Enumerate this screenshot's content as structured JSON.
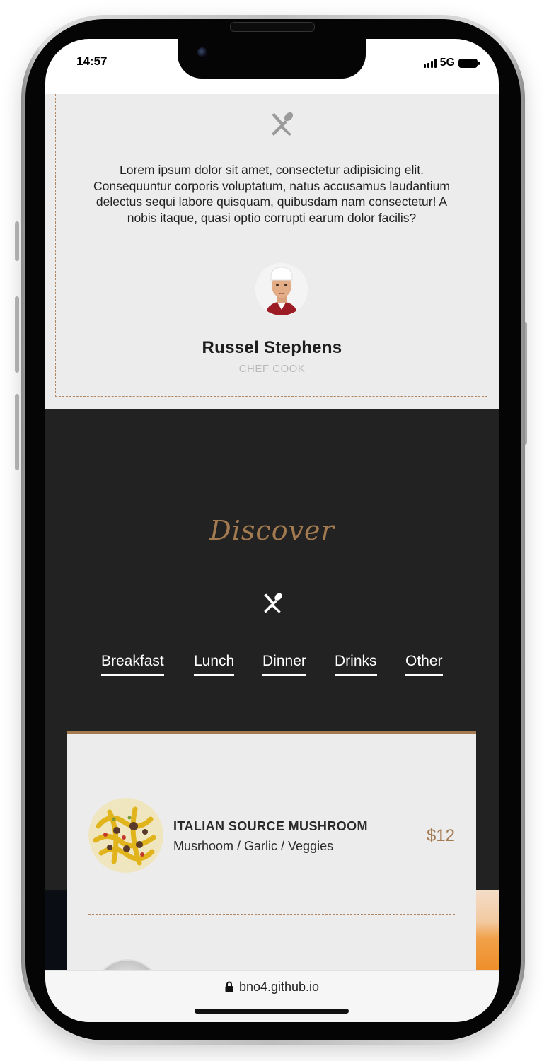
{
  "status_bar": {
    "time": "14:57",
    "network": "5G"
  },
  "testimonial": {
    "icon": "utensils-icon",
    "quote": "Lorem ipsum dolor sit amet, consectetur adipisicing elit. Consequuntur corporis voluptatum, natus accusamus laudantium delectus sequi labore quisquam, quibusdam nam consectetur! A nobis itaque, quasi optio corrupti earum dolor facilis?",
    "author_name": "Russel Stephens",
    "author_role": "CHEF COOK"
  },
  "discover": {
    "title": "Discover",
    "icon": "utensils-icon",
    "tabs": [
      "Breakfast",
      "Lunch",
      "Dinner",
      "Drinks",
      "Other"
    ]
  },
  "menu": {
    "items": [
      {
        "name": "ITALIAN SOURCE MUSHROOM",
        "ingredients": "Musrhoom / Garlic / Veggies",
        "price": "$12"
      }
    ]
  },
  "browser": {
    "url": "bno4.github.io"
  },
  "colors": {
    "accent": "#a47a50",
    "dark_bg": "#222222",
    "card_bg": "#ececec"
  }
}
